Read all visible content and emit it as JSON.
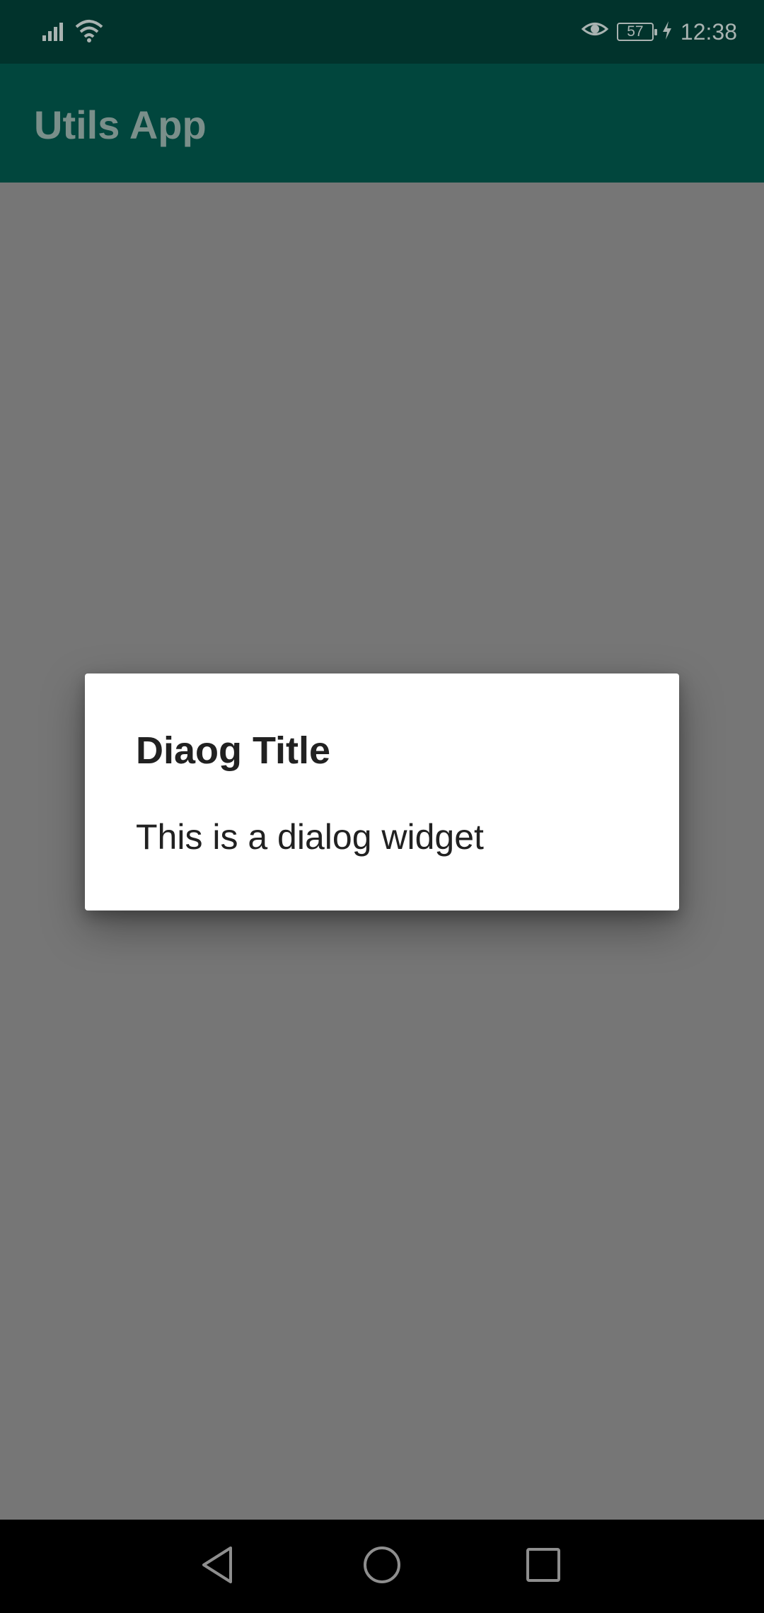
{
  "status_bar": {
    "time": "12:38",
    "battery_level": "57",
    "icons": [
      "signal-icon",
      "wifi-icon",
      "eye-comfort-icon",
      "battery-icon",
      "charging-icon"
    ]
  },
  "app_bar": {
    "title": "Utils App"
  },
  "dialog": {
    "title": "Diaog Title",
    "message": "This is a dialog widget"
  },
  "nav_bar": {
    "buttons": [
      "back-icon",
      "home-icon",
      "recents-icon"
    ]
  },
  "colors": {
    "scrim": "#767676",
    "status_bar": "#01332c",
    "app_bar": "#01463d",
    "dialog_bg": "#ffffff",
    "text_primary": "#212121"
  }
}
